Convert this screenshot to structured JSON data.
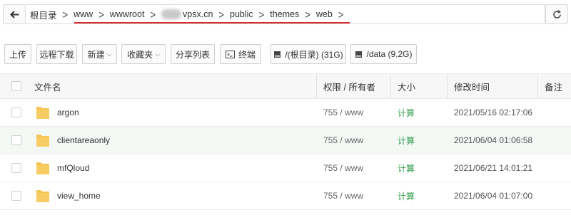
{
  "breadcrumb": {
    "items": [
      "根目录",
      "www",
      "wwwroot",
      "vpsx.cn",
      "public",
      "themes",
      "web"
    ]
  },
  "toolbar": {
    "upload": "上传",
    "remote_download": "远程下载",
    "new": "新建",
    "favorites": "收藏夹",
    "share_list": "分享列表",
    "terminal": "终端",
    "disk_root": "/(根目录) (31G)",
    "disk_data": "/data (9.2G)"
  },
  "table": {
    "headers": {
      "name": "文件名",
      "perm": "权限 / 所有者",
      "size": "大小",
      "mtime": "修改时间",
      "note": "备注"
    },
    "rows": [
      {
        "name": "argon",
        "perm": "755 / www",
        "size": "计算",
        "mtime": "2021/05/16 02:17:06"
      },
      {
        "name": "clientareaonly",
        "perm": "755 / www",
        "size": "计算",
        "mtime": "2021/06/04 01:06:58"
      },
      {
        "name": "mfQloud",
        "perm": "755 / www",
        "size": "计算",
        "mtime": "2021/06/21 14:01:21"
      },
      {
        "name": "view_home",
        "perm": "755 / www",
        "size": "计算",
        "mtime": "2021/06/04 01:07:00"
      }
    ]
  },
  "colors": {
    "highlight_underline": "#d42d2d",
    "size_link": "#2e9b47",
    "folder": "#f5c452",
    "row_highlight": "#f3f8f5"
  }
}
